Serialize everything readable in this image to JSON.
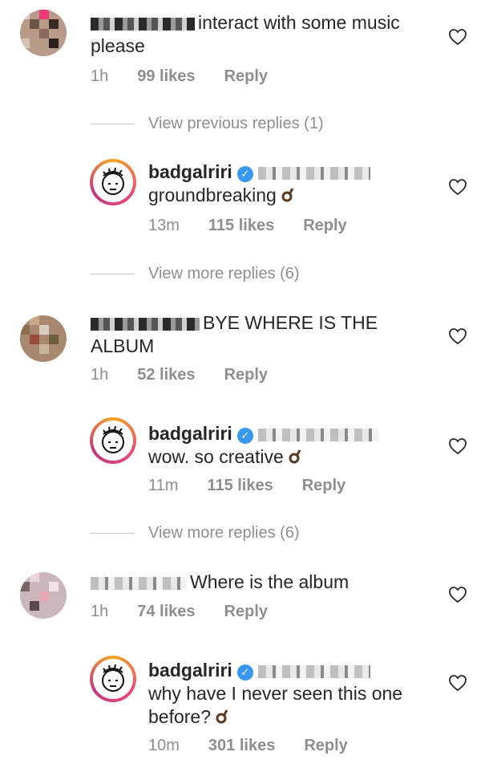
{
  "comments": [
    {
      "text_line1": "interact with some music",
      "text_line2": "please",
      "time": "1h",
      "likes": "99 likes",
      "reply": "Reply"
    },
    {
      "username": "badgalriri",
      "text": "groundbreaking",
      "emoji": "ok-hand",
      "time": "13m",
      "likes": "115 likes",
      "reply": "Reply"
    },
    {
      "text_line1": "BYE WHERE IS THE",
      "text_line2": "ALBUM",
      "time": "1h",
      "likes": "52 likes",
      "reply": "Reply"
    },
    {
      "username": "badgalriri",
      "text": "wow. so creative",
      "emoji": "ok-hand",
      "time": "11m",
      "likes": "115 likes",
      "reply": "Reply"
    },
    {
      "text_line1": "Where is the album",
      "time": "1h",
      "likes": "74 likes",
      "reply": "Reply"
    },
    {
      "username": "badgalriri",
      "text_line1": "why have I never seen this one",
      "text_line2": "before?",
      "emoji": "ok-hand",
      "time": "10m",
      "likes": "301 likes",
      "reply": "Reply"
    }
  ],
  "view_previous": "View previous replies (1)",
  "view_more_1": "View more replies (6)",
  "view_more_2": "View more replies (6)",
  "colors": {
    "verified": "#3897f0",
    "meta": "#8e8e8e"
  }
}
